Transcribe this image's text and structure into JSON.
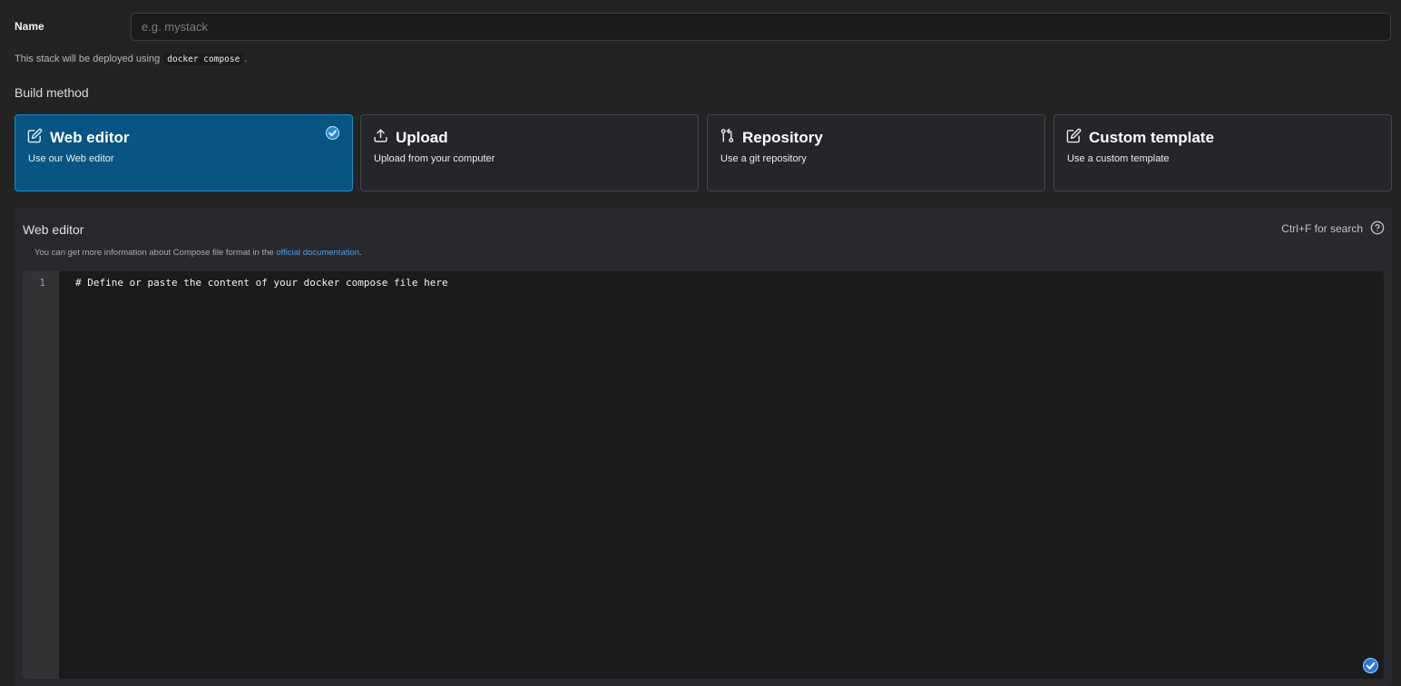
{
  "name_field": {
    "label": "Name",
    "placeholder": "e.g. mystack",
    "value": ""
  },
  "deploy_note": {
    "prefix": "This stack will be deployed using",
    "command": "docker compose",
    "suffix": "."
  },
  "build_method": {
    "title": "Build method",
    "options": [
      {
        "title": "Web editor",
        "description": "Use our Web editor",
        "icon": "edit-icon",
        "selected": true
      },
      {
        "title": "Upload",
        "description": "Upload from your computer",
        "icon": "upload-icon",
        "selected": false
      },
      {
        "title": "Repository",
        "description": "Use a git repository",
        "icon": "git-pull-request-icon",
        "selected": false
      },
      {
        "title": "Custom template",
        "description": "Use a custom template",
        "icon": "edit-icon",
        "selected": false
      }
    ]
  },
  "editor": {
    "title": "Web editor",
    "search_hint": "Ctrl+F for search",
    "doc_note_prefix": "You can get more information about Compose file format in the",
    "doc_link_text": "official documentation",
    "doc_note_suffix": ".",
    "line_number": "1",
    "content": "# Define or paste the content of your docker compose file here"
  },
  "colors": {
    "background": "#232324",
    "selected_card": "#075583",
    "selected_border": "#1c8bc8",
    "link": "#4a9ff0",
    "check_badge": "#1f8ad8"
  }
}
